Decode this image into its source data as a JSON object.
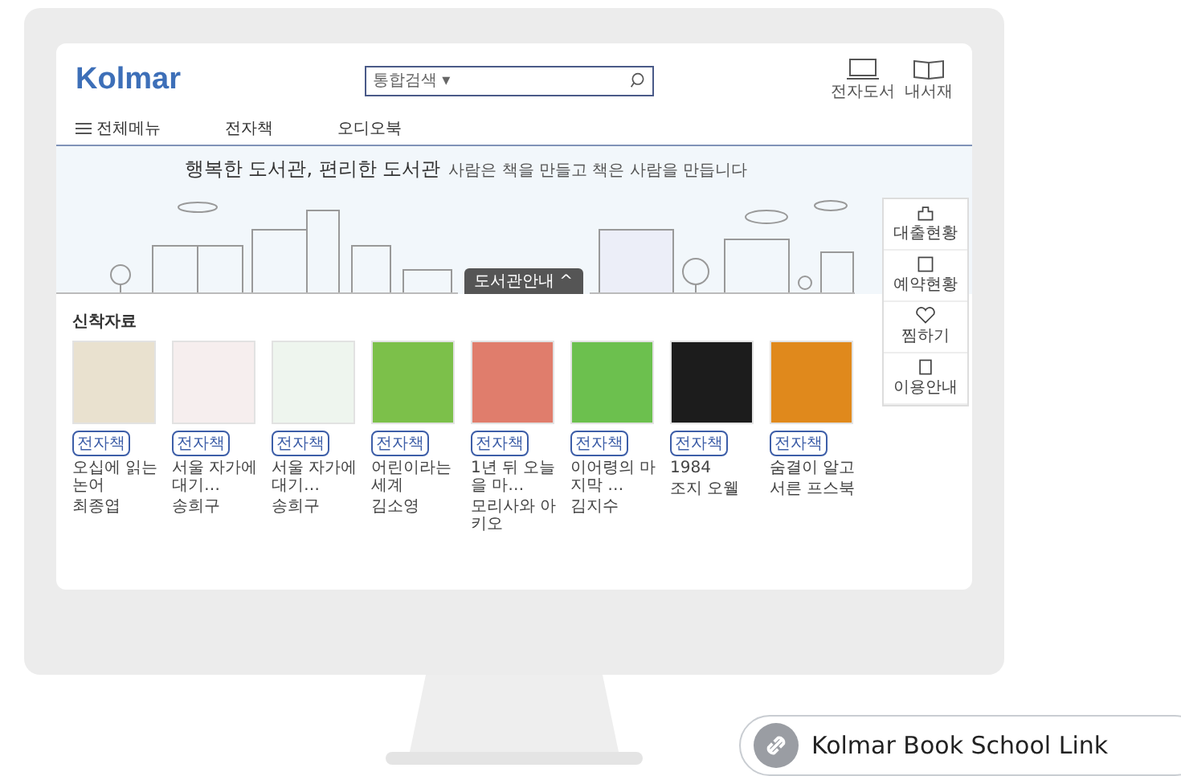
{
  "site": {
    "logo": "Kolmar",
    "search": {
      "scope": "통합검색",
      "caret": "▾"
    },
    "header_links": [
      {
        "label": "전자도서"
      },
      {
        "label": "내서재"
      }
    ],
    "nav": [
      {
        "label": "전체메뉴",
        "kind": "menu"
      },
      {
        "label": "전자책",
        "kind": "link"
      },
      {
        "label": "오디오북",
        "kind": "link"
      }
    ]
  },
  "banner": {
    "headline": "행복한 도서관, 편리한 도서관",
    "tagline": "사람은 책을 만들고 책은 사람을 만듭니다",
    "button": "도서관안내 ^"
  },
  "quick_menu": [
    {
      "label": "대출현황",
      "kind": "building"
    },
    {
      "label": "예약현황",
      "kind": "card"
    },
    {
      "label": "찜하기",
      "kind": "heart"
    },
    {
      "label": "이용안내",
      "kind": "guide"
    }
  ],
  "new_arrivals": {
    "title": "신착자료",
    "books": [
      {
        "badge": "전자책",
        "title": "오십에 읽는 논어",
        "author": "최종엽",
        "color": "#e9e1cf"
      },
      {
        "badge": "전자책",
        "title": "서울 자가에 대기…",
        "author": "송희구",
        "color": "#f6eeee"
      },
      {
        "badge": "전자책",
        "title": "서울 자가에 대기…",
        "author": "송희구",
        "color": "#eef5ee"
      },
      {
        "badge": "전자책",
        "title": "어린이라는 세계",
        "author": "김소영",
        "color": "#7cc04a"
      },
      {
        "badge": "전자책",
        "title": "1년 뒤 오늘을 마…",
        "author": "모리사와 아키오",
        "color": "#e07d6c"
      },
      {
        "badge": "전자책",
        "title": "이어령의 마지막 …",
        "author": "김지수",
        "color": "#6cc04e"
      },
      {
        "badge": "전자책",
        "title": "1984",
        "author": "조지 오웰",
        "color": "#1c1c1c"
      },
      {
        "badge": "전자책",
        "title": "숨결이 알고",
        "author": "서른 프스북",
        "color": "#e0891c"
      }
    ]
  },
  "link_button": {
    "label": "Kolmar Book School Link"
  }
}
